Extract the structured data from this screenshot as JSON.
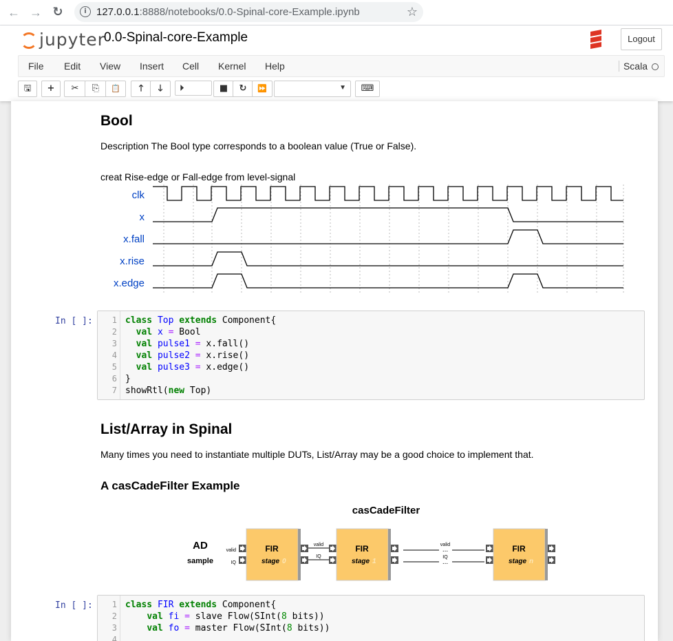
{
  "browser": {
    "back": "←",
    "forward": "→",
    "reload": "↻",
    "url_host": "127.0.0.1",
    "url_rest": ":8888/notebooks/0.0-Spinal-core-Example.ipynb",
    "info": "i",
    "star": "☆"
  },
  "header": {
    "logo_text": "jupyter",
    "notebook_title": "0.0-Spinal-core-Example",
    "logout": "Logout",
    "brand_color": "#de3423"
  },
  "menu": [
    "File",
    "Edit",
    "View",
    "Insert",
    "Cell",
    "Kernel",
    "Help"
  ],
  "kernel": {
    "name": "Scala"
  },
  "toolbar": {
    "save": "🖫",
    "add": "+",
    "cut": "✂",
    "copy": "⎘",
    "paste": "📋",
    "up": "🡑",
    "down": "🡓",
    "run": "⏵",
    "stop": "■",
    "restart": "↻",
    "fastforward": "⏩",
    "celltype_arrow": "▼",
    "keyboard": "⌨"
  },
  "cells": {
    "bool_heading": "Bool",
    "bool_desc": "Description The Bool type corresponds to a boolean value (True or False).",
    "wave_caption": "creat Rise-edge or Fall-edge from level-signal",
    "wave_signals": [
      "clk",
      "x",
      "x.fall",
      "x.rise",
      "x.edge"
    ],
    "prompt1": "In [ ]:",
    "code1": [
      {
        "n": "1"
      },
      {
        "n": "2"
      },
      {
        "n": "3"
      },
      {
        "n": "4"
      },
      {
        "n": "5"
      },
      {
        "n": "6"
      },
      {
        "n": "7"
      }
    ],
    "list_heading": "List/Array in Spinal",
    "list_desc": "Many times you need to instantiate multiple DUTs, List/Array may be a good choice to implement that.",
    "example_heading": "A casCadeFilter Example",
    "diagram": {
      "title": "casCadeFilter",
      "source_top": "AD",
      "source_bottom": "sample",
      "port_valid": "valid",
      "port_iq": "IQ",
      "fir": "FIR",
      "stage": "stage",
      "stage_suffixes": [
        "0",
        "1",
        "n"
      ],
      "ellipsis": "...",
      "block_color": "#fcc96a"
    },
    "prompt2": "In [ ]:",
    "code2": [
      {
        "n": "1"
      },
      {
        "n": "2"
      },
      {
        "n": "3"
      },
      {
        "n": "4"
      }
    ]
  }
}
